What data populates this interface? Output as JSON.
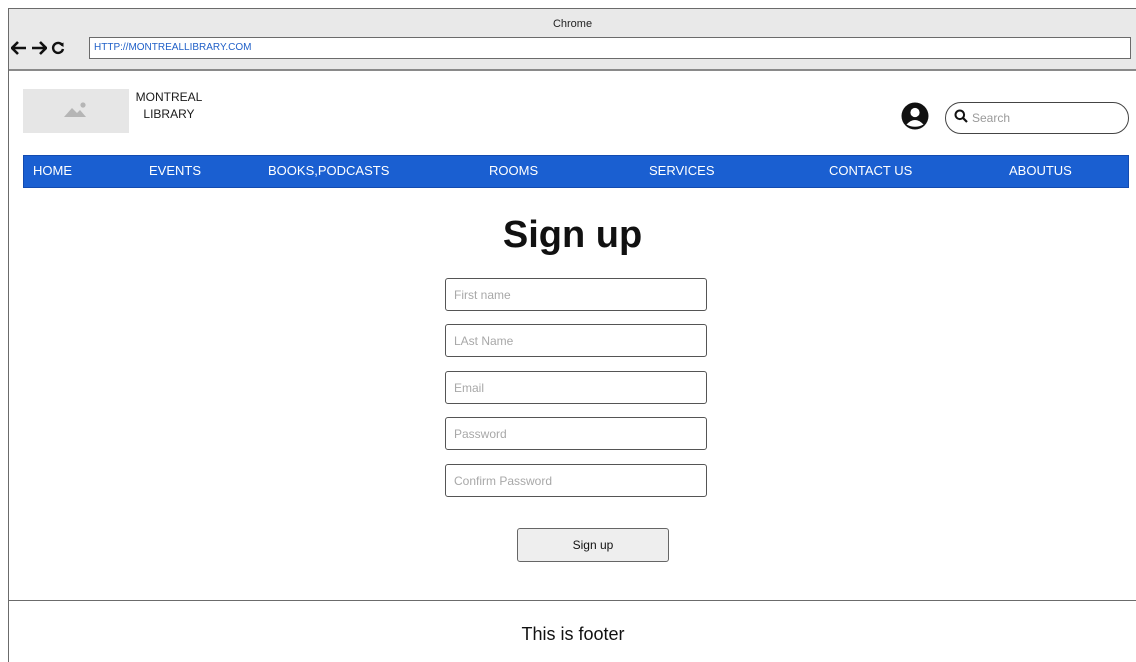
{
  "browser": {
    "title": "Chrome",
    "url": "HTTP://MONTREALLIBRARY.COM"
  },
  "header": {
    "brand_line1": "MONTREAL",
    "brand_line2": "LIBRARY",
    "search_placeholder": "Search"
  },
  "nav": {
    "items": [
      "HOME",
      "EVENTS",
      "BOOKS,PODCASTS",
      "ROOMS",
      "SERVICES",
      "CONTACT US",
      "ABOUTUS"
    ]
  },
  "form": {
    "title": "Sign up",
    "fields": {
      "first_name": "First name",
      "last_name": "LAst Name",
      "email": "Email",
      "password": "Password",
      "confirm_password": "Confirm Password"
    },
    "submit_label": "Sign up"
  },
  "footer": {
    "text": "This is footer"
  },
  "colors": {
    "nav_background": "#1a5fd1",
    "nav_text": "#ffffff",
    "url_text": "#2060c8"
  }
}
